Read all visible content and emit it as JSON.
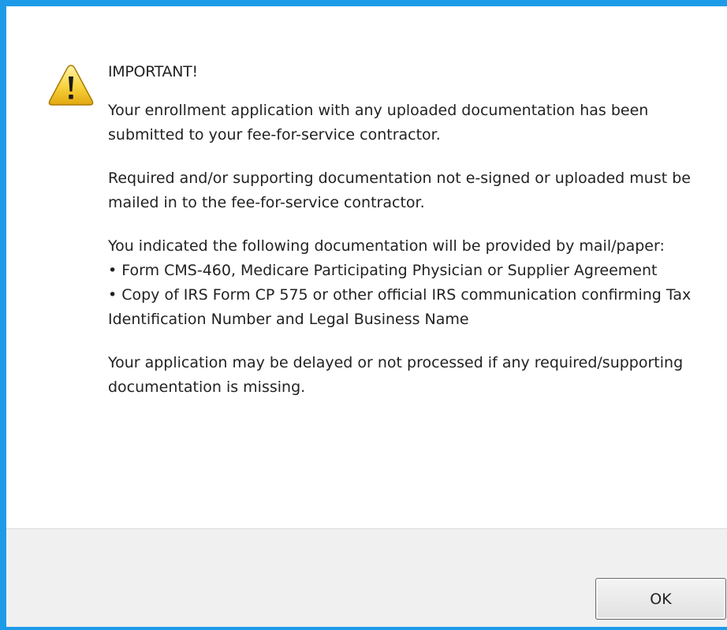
{
  "colors": {
    "window_frame": "#1E9BE8",
    "footer_background": "#F0F0F0",
    "text": "#222222"
  },
  "icon": "warning-triangle-icon",
  "message": {
    "title": "IMPORTANT!",
    "paragraph_1": "Your enrollment application with any uploaded documentation has been submitted to your fee-for-service contractor.",
    "paragraph_2": "Required and/or supporting documentation not e-signed or uploaded must be mailed in to the fee-for-service contractor.",
    "documentation_intro": "You indicated the following documentation will be provided by mail/paper:",
    "documentation_items": [
      {
        "bullet": "•",
        "text": "Form CMS-460, Medicare Participating Physician or Supplier Agreement"
      },
      {
        "bullet": "•",
        "text": "Copy of IRS Form CP 575 or other official IRS communication confirming Tax Identification Number and Legal Business Name"
      }
    ],
    "paragraph_4": "Your application may be delayed or not processed if any required/supporting documentation is missing."
  },
  "buttons": {
    "ok_label": "OK"
  }
}
